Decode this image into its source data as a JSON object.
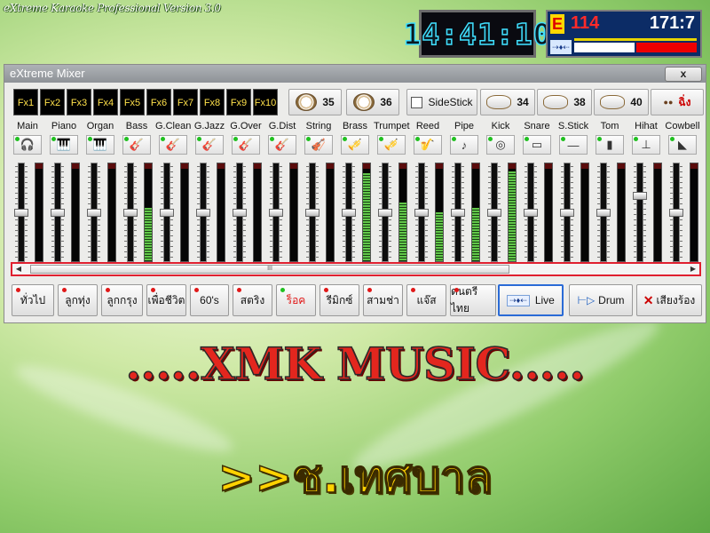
{
  "app_title": "eXtreme Karaoke Professional Version 3.0",
  "clock": "14:41:10",
  "status": {
    "e_label": "E",
    "tempo": "114",
    "bar_beat": "171:7",
    "wave_icon": "audio-wave-icon",
    "meter_colors": {
      "left": "#ffffff",
      "right": "#ee0000"
    }
  },
  "mixer": {
    "title": "eXtreme Mixer",
    "close_label": "x",
    "fx_buttons": [
      "Fx1",
      "Fx2",
      "Fx3",
      "Fx4",
      "Fx5",
      "Fx6",
      "Fx7",
      "Fx8",
      "Fx9",
      "Fx10"
    ],
    "pads": [
      {
        "icon": "drum-icon",
        "label": "35"
      },
      {
        "icon": "drum-icon",
        "label": "36"
      },
      {
        "icon": "checkbox-icon",
        "label": "SideStick"
      },
      {
        "icon": "snare-icon",
        "label": "34"
      },
      {
        "icon": "snare-icon",
        "label": "38"
      },
      {
        "icon": "snare-icon",
        "label": "40"
      },
      {
        "icon": "ching-icon",
        "label": "ฉิ่ง"
      }
    ],
    "channels": [
      {
        "label": "Main",
        "icon": "headphones-icon",
        "glyph": "🎧",
        "level": 0.0,
        "fader": 0.5
      },
      {
        "label": "Piano",
        "icon": "piano-icon",
        "glyph": "🎹",
        "level": 0.0,
        "fader": 0.5
      },
      {
        "label": "Organ",
        "icon": "organ-icon",
        "glyph": "🎹",
        "level": 0.0,
        "fader": 0.5
      },
      {
        "label": "Bass",
        "icon": "bass-guitar-icon",
        "glyph": "🎸",
        "level": 0.55,
        "fader": 0.5
      },
      {
        "label": "G.Clean",
        "icon": "guitar-clean-icon",
        "glyph": "🎸",
        "level": 0.0,
        "fader": 0.5
      },
      {
        "label": "G.Jazz",
        "icon": "guitar-jazz-icon",
        "glyph": "🎸",
        "level": 0.0,
        "fader": 0.5
      },
      {
        "label": "G.Over",
        "icon": "guitar-overdrive-icon",
        "glyph": "🎸",
        "level": 0.0,
        "fader": 0.5
      },
      {
        "label": "G.Dist",
        "icon": "guitar-distortion-icon",
        "glyph": "🎸",
        "level": 0.0,
        "fader": 0.5
      },
      {
        "label": "String",
        "icon": "violin-icon",
        "glyph": "🎻",
        "level": 0.0,
        "fader": 0.5
      },
      {
        "label": "Brass",
        "icon": "trombone-icon",
        "glyph": "🎺",
        "level": 0.9,
        "fader": 0.5
      },
      {
        "label": "Trumpet",
        "icon": "trumpet-icon",
        "glyph": "🎺",
        "level": 0.6,
        "fader": 0.5
      },
      {
        "label": "Reed",
        "icon": "saxophone-icon",
        "glyph": "🎷",
        "level": 0.5,
        "fader": 0.5
      },
      {
        "label": "Pipe",
        "icon": "flute-icon",
        "glyph": "♪",
        "level": 0.55,
        "fader": 0.5
      },
      {
        "label": "Kick",
        "icon": "kick-drum-icon",
        "glyph": "◎",
        "level": 0.92,
        "fader": 0.5
      },
      {
        "label": "Snare",
        "icon": "snare-drum-icon",
        "glyph": "▭",
        "level": 0.0,
        "fader": 0.5
      },
      {
        "label": "S.Stick",
        "icon": "drumstick-icon",
        "glyph": "―",
        "level": 0.0,
        "fader": 0.5
      },
      {
        "label": "Tom",
        "icon": "tom-drum-icon",
        "glyph": "▮",
        "level": 0.0,
        "fader": 0.5
      },
      {
        "label": "Hihat",
        "icon": "hihat-icon",
        "glyph": "⊥",
        "level": 0.0,
        "fader": 0.68
      },
      {
        "label": "Cowbell",
        "icon": "cowbell-icon",
        "glyph": "◣",
        "level": 0.0,
        "fader": 0.5
      }
    ],
    "scroll_thumb_label": "III",
    "styles": [
      {
        "label": "ทั่วไป",
        "active": false
      },
      {
        "label": "ลูกทุ่ง",
        "active": false
      },
      {
        "label": "ลูกกรุง",
        "active": false
      },
      {
        "label": "เพื่อชีวิต",
        "active": false
      },
      {
        "label": "60's",
        "active": false
      },
      {
        "label": "สตริง",
        "active": false
      },
      {
        "label": "ร็อค",
        "active": true
      },
      {
        "label": "รีมิกซ์",
        "active": false
      },
      {
        "label": "สามช่า",
        "active": false
      },
      {
        "label": "แจ๊ส",
        "active": false
      },
      {
        "label": "ดนตรีไทย",
        "active": false
      }
    ],
    "modes": [
      {
        "label": "Live",
        "icon": "live-wave-icon"
      },
      {
        "label": "Drum",
        "icon": "drum-pattern-icon"
      },
      {
        "label": "เสียงร้อง",
        "icon": "mute-vocal-icon"
      }
    ]
  },
  "banner": {
    "line1": ".....XMK MUSIC.....",
    "line2": ">>ช.เทศบาล"
  }
}
